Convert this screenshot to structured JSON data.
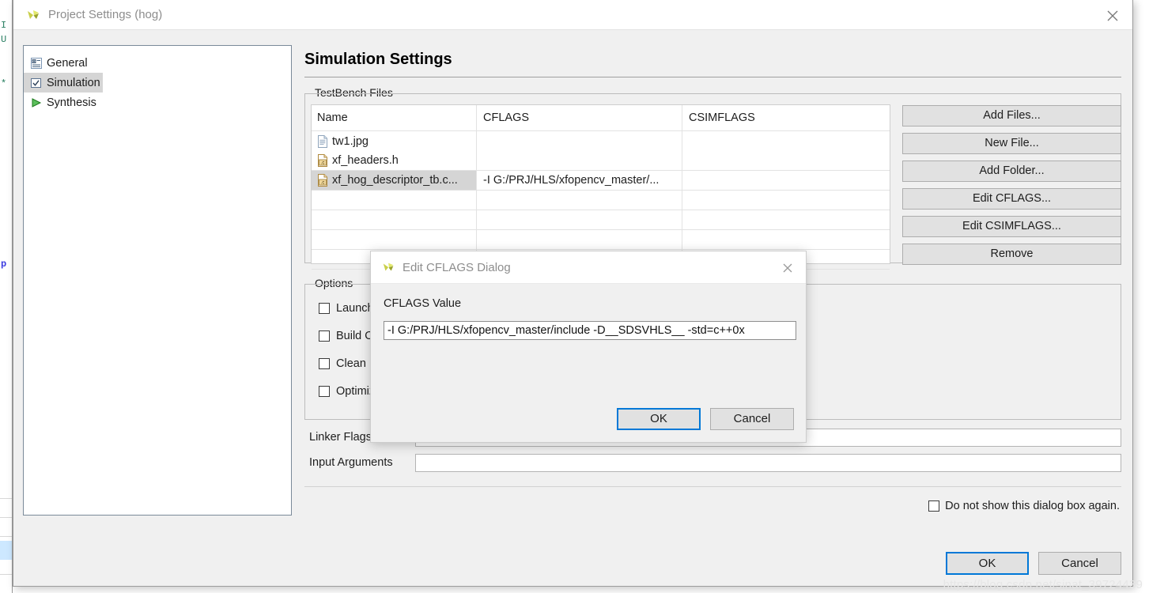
{
  "window": {
    "title": "Project Settings (hog)",
    "close_icon": "close-icon",
    "app_icon": "vitis-hls-logo-icon"
  },
  "tree": {
    "items": [
      {
        "label": "General",
        "icon": "general-properties-icon",
        "selected": false
      },
      {
        "label": "Simulation",
        "icon": "checkbox-checked-icon",
        "selected": true
      },
      {
        "label": "Synthesis",
        "icon": "green-play-icon",
        "selected": false
      }
    ]
  },
  "panel": {
    "page_title": "Simulation Settings"
  },
  "testbench": {
    "legend": "TestBench Files",
    "columns": [
      "Name",
      "CFLAGS",
      "CSIMFLAGS"
    ],
    "rows": [
      {
        "name": "tw1.jpg",
        "icon": "image-file-icon",
        "cflags": "",
        "csimflags": "",
        "selected": false
      },
      {
        "name": "xf_headers.h",
        "icon": "c-source-file-icon",
        "cflags": "",
        "csimflags": "",
        "selected": false
      },
      {
        "name": "xf_hog_descriptor_tb.c...",
        "icon": "c-source-file-icon",
        "cflags": "-I G:/PRJ/HLS/xfopencv_master/...",
        "csimflags": "",
        "selected": true
      },
      {
        "name": "",
        "icon": "",
        "cflags": "",
        "csimflags": "",
        "selected": false
      },
      {
        "name": "",
        "icon": "",
        "cflags": "",
        "csimflags": "",
        "selected": false
      },
      {
        "name": "",
        "icon": "",
        "cflags": "",
        "csimflags": "",
        "selected": false
      },
      {
        "name": "",
        "icon": "",
        "cflags": "",
        "csimflags": "",
        "selected": false
      }
    ],
    "buttons": [
      "Add Files...",
      "New File...",
      "Add Folder...",
      "Edit CFLAGS...",
      "Edit CSIMFLAGS...",
      "Remove"
    ]
  },
  "options": {
    "legend": "Options",
    "items": [
      {
        "label": "Launch",
        "checked": false
      },
      {
        "label": "Build O",
        "checked": false
      },
      {
        "label": "Clean B",
        "checked": false
      },
      {
        "label": "Optimiz",
        "checked": false
      }
    ]
  },
  "flags": {
    "linker_label": "Linker Flags",
    "linker_value": "",
    "linker_placeholder": "",
    "input_args_label": "Input Arguments",
    "input_args_value": "",
    "input_args_placeholder": ""
  },
  "do_not_show": {
    "label": "Do not show this dialog box again.",
    "checked": false
  },
  "bottom_buttons": {
    "ok": "OK",
    "cancel": "Cancel"
  },
  "modal": {
    "title": "Edit CFLAGS Dialog",
    "app_icon": "vitis-hls-logo-icon",
    "close_icon": "close-icon",
    "field_label": "CFLAGS Value",
    "field_value": "-I G:/PRJ/HLS/xfopencv_master/include -D__SDSVHLS__ -std=c++0x",
    "field_placeholder": "",
    "ok": "OK",
    "cancel": "Cancel"
  },
  "background": {
    "editor_glyphs": [
      "I",
      "U",
      "*",
      "p"
    ]
  },
  "watermark": "https://blog.csdn.net/sinat_39724439",
  "colors": {
    "accent_blue": "#0078d7",
    "dialog_bg": "#f0f0f0",
    "titlebar_bg": "#ffffff",
    "selection_gray": "#d5d5d5",
    "button_bg": "#e1e1e1"
  }
}
